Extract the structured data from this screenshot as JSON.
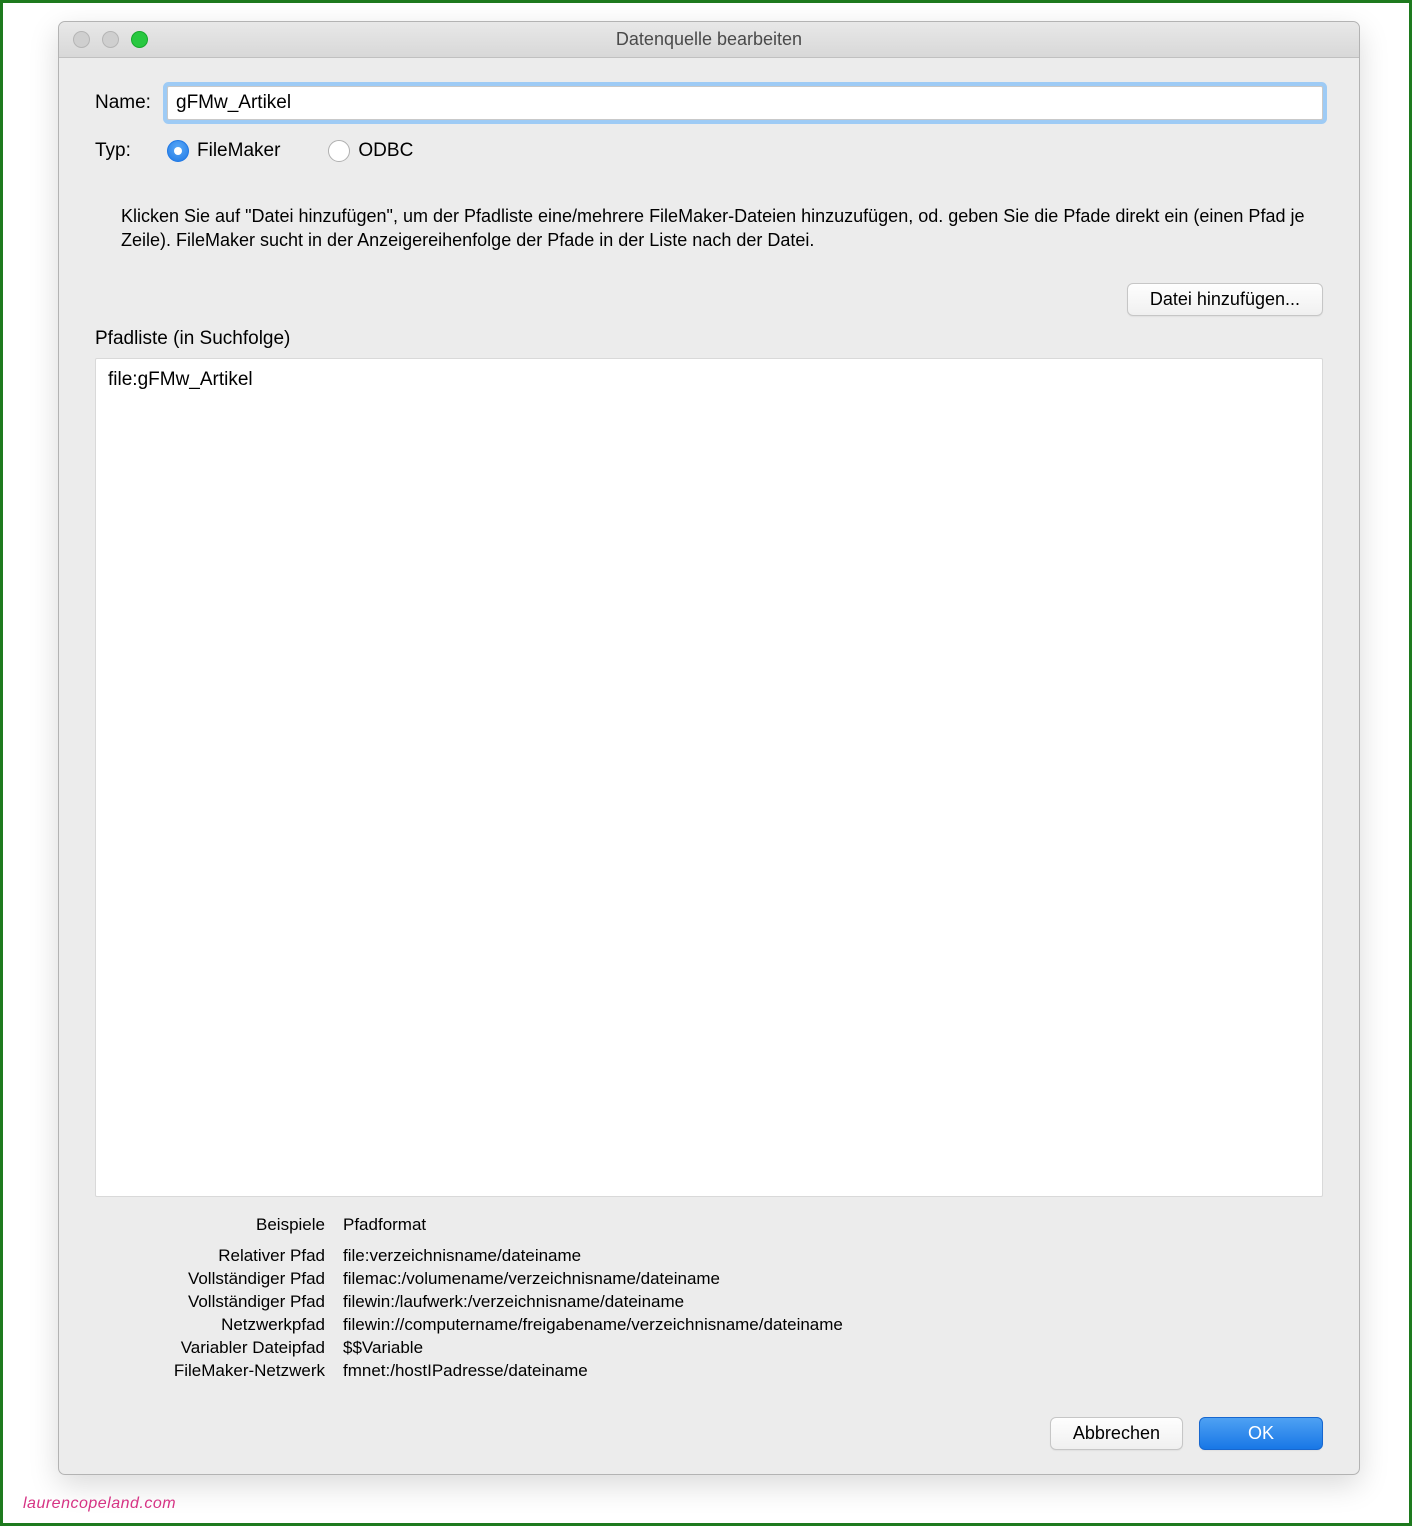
{
  "window": {
    "title": "Datenquelle bearbeiten"
  },
  "form": {
    "name_label": "Name:",
    "name_value": "gFMw_Artikel",
    "type_label": "Typ:",
    "type_options": {
      "filemaker": "FileMaker",
      "odbc": "ODBC"
    }
  },
  "help_text": "Klicken Sie auf \"Datei hinzufügen\", um der Pfadliste eine/mehrere FileMaker-Dateien hinzuzufügen, od. geben Sie die Pfade direkt ein (einen Pfad je Zeile). FileMaker sucht in der Anzeigereihenfolge der Pfade in der Liste nach der Datei.",
  "buttons": {
    "add_file": "Datei hinzufügen...",
    "cancel": "Abbrechen",
    "ok": "OK"
  },
  "pathlist": {
    "label": "Pfadliste (in Suchfolge)",
    "content": "file:gFMw_Artikel"
  },
  "examples": {
    "header_left": "Beispiele",
    "header_right": "Pfadformat",
    "rows": [
      {
        "l": "Relativer Pfad",
        "r": "file:verzeichnisname/dateiname"
      },
      {
        "l": "Vollständiger Pfad",
        "r": "filemac:/volumename/verzeichnisname/dateiname"
      },
      {
        "l": "Vollständiger Pfad",
        "r": "filewin:/laufwerk:/verzeichnisname/dateiname"
      },
      {
        "l": "Netzwerkpfad",
        "r": "filewin://computername/freigabename/verzeichnisname/dateiname"
      },
      {
        "l": "Variabler Dateipfad",
        "r": "$$Variable"
      },
      {
        "l": "FileMaker-Netzwerk",
        "r": "fmnet:/hostIPadresse/dateiname"
      }
    ]
  },
  "watermark": "laurencopeland.com"
}
